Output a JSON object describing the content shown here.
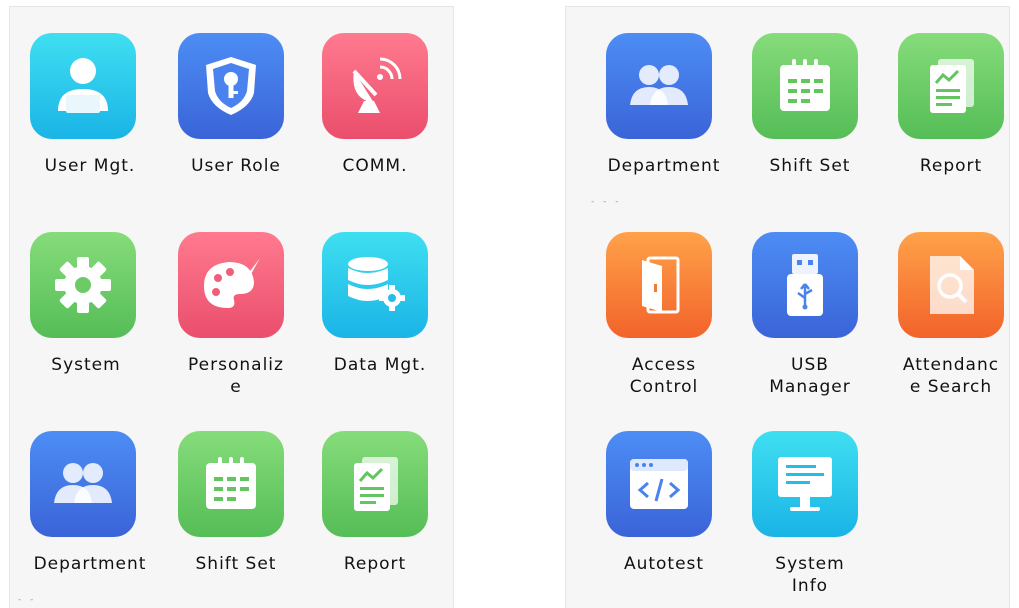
{
  "panels": [
    {
      "tiles": [
        {
          "label": "User Mgt.",
          "icon": "user-icon"
        },
        {
          "label": "User Role",
          "icon": "shield-key-icon"
        },
        {
          "label": "COMM.",
          "icon": "satellite-dish-icon"
        },
        {
          "label": "System",
          "icon": "gear-icon"
        },
        {
          "label": "Personaliz\ne",
          "icon": "palette-icon"
        },
        {
          "label": "Data Mgt.",
          "icon": "database-gear-icon"
        },
        {
          "label": "Department",
          "icon": "people-icon"
        },
        {
          "label": "Shift Set",
          "icon": "calendar-icon"
        },
        {
          "label": "Report",
          "icon": "report-icon"
        }
      ]
    },
    {
      "tiles": [
        {
          "label": "Department",
          "icon": "people-icon"
        },
        {
          "label": "Shift Set",
          "icon": "calendar-icon"
        },
        {
          "label": "Report",
          "icon": "report-icon"
        },
        {
          "label": "Access\nControl",
          "icon": "door-icon"
        },
        {
          "label": "USB\nManager",
          "icon": "usb-drive-icon"
        },
        {
          "label": "Attendanc\ne Search",
          "icon": "document-search-icon"
        },
        {
          "label": "Autotest",
          "icon": "code-window-icon"
        },
        {
          "label": "System\nInfo",
          "icon": "monitor-icon"
        }
      ]
    }
  ],
  "colors": {
    "cyan": "#1ab4e6",
    "blue": "#3a64d8",
    "pink": "#ea4e6c",
    "green": "#55bd57",
    "orange": "#f2632a",
    "screen_bg": "#f6f6f6"
  }
}
